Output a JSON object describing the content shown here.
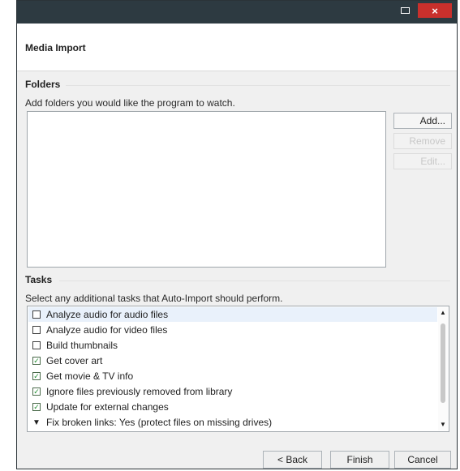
{
  "window": {
    "close_glyph": "×",
    "minimize_icon": "minimize-icon",
    "close_icon": "close-icon"
  },
  "header": {
    "title": "Media Import"
  },
  "folders": {
    "title": "Folders",
    "description": "Add folders you would like the program to watch.",
    "buttons": {
      "add": "Add...",
      "remove": "Remove",
      "edit": "Edit..."
    }
  },
  "tasks": {
    "title": "Tasks",
    "description": "Select any additional tasks that Auto-Import should perform.",
    "items": [
      {
        "label": "Analyze audio for audio files",
        "checked": false,
        "selected": true
      },
      {
        "label": "Analyze audio for video files",
        "checked": false
      },
      {
        "label": "Build thumbnails",
        "checked": false
      },
      {
        "label": "Get cover art",
        "checked": true
      },
      {
        "label": "Get movie & TV info",
        "checked": true
      },
      {
        "label": "Ignore files previously removed from library",
        "checked": true
      },
      {
        "label": "Update for external changes",
        "checked": true
      },
      {
        "label": "Fix broken links: Yes (protect files on missing drives)",
        "expander": true
      }
    ]
  },
  "footer": {
    "back": "< Back",
    "finish": "Finish",
    "cancel": "Cancel"
  },
  "colors": {
    "titlebar": "#2d3a41",
    "close": "#c9302c",
    "check": "#1e8d2d"
  }
}
